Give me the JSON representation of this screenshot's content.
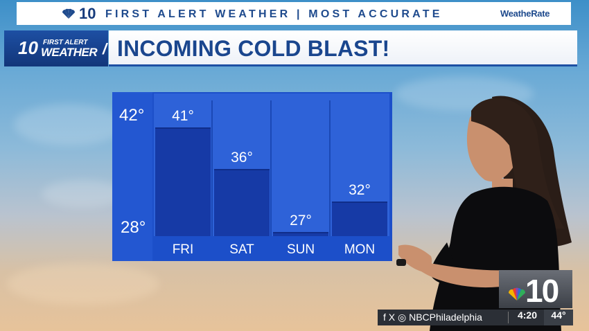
{
  "banner": {
    "channel": "10",
    "slogan": "FIRST ALERT WEATHER | MOST ACCURATE",
    "rating_brand": "WeatheRate"
  },
  "logo": {
    "number": "10",
    "line1": "FIRST ALERT",
    "line2": "WEATHER"
  },
  "headline": "INCOMING COLD BLAST!",
  "chart_data": {
    "type": "bar",
    "categories": [
      "FRI",
      "SAT",
      "SUN",
      "MON"
    ],
    "values": [
      41,
      36,
      27,
      32
    ],
    "value_labels": [
      "41°",
      "36°",
      "27°",
      "32°"
    ],
    "ylim": [
      28,
      42
    ],
    "y_tick_labels": [
      "42°",
      "28°"
    ],
    "title": "",
    "xlabel": "",
    "ylabel": "",
    "grid": true
  },
  "bug": {
    "number": "10"
  },
  "ticker": {
    "social": "f X ◎ NBCPhiladelphia",
    "time": "4:20",
    "temperature": "44°"
  },
  "colors": {
    "brand_blue": "#1a468e",
    "chart_bg": "#1c4fc9",
    "bar": "#163aa6"
  }
}
